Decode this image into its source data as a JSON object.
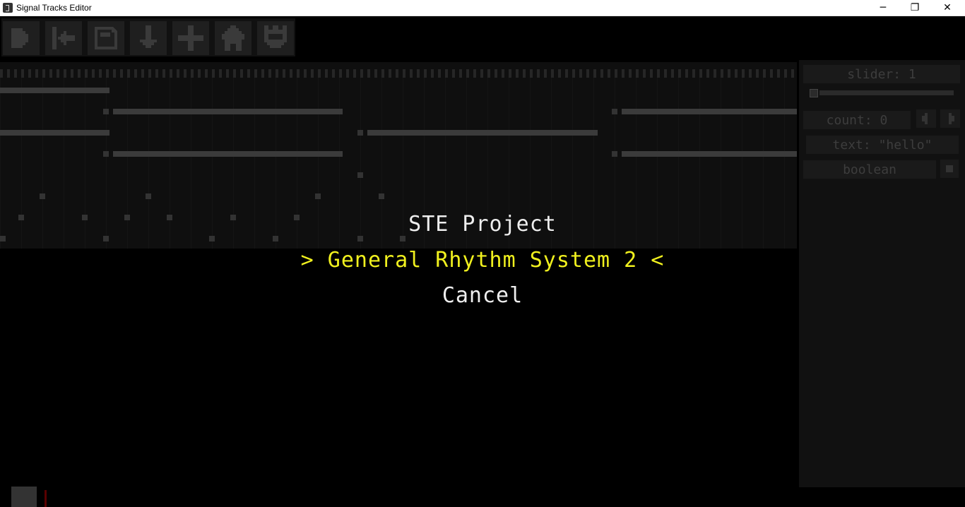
{
  "window": {
    "title": "Signal Tracks Editor",
    "minimize_glyph": "─",
    "restore_glyph": "❐",
    "close_glyph": "✕"
  },
  "toolbar": {
    "buttons": [
      {
        "icon": "play-icon"
      },
      {
        "icon": "skip-to-start-icon"
      },
      {
        "icon": "save-icon"
      },
      {
        "icon": "download-icon"
      },
      {
        "icon": "add-icon"
      },
      {
        "icon": "home-icon"
      },
      {
        "icon": "crown-icon"
      }
    ]
  },
  "sidebar": {
    "slider_label": "slider: 1",
    "slider_value": 1,
    "count_label": "count: 0",
    "count_value": 0,
    "text_label": "text: \"hello\"",
    "text_value": "hello",
    "boolean_label": "boolean",
    "boolean_checked": false
  },
  "dialog": {
    "title": "STE Project",
    "items": [
      {
        "label": "> General Rhythm System 2 <",
        "selected": true
      },
      {
        "label": "Cancel",
        "selected": false
      }
    ]
  },
  "colors": {
    "background": "#000000",
    "selected_text": "#f0f01e",
    "text": "#eeeeee",
    "panel": "#111111",
    "inactive": "#3d3d3d"
  }
}
